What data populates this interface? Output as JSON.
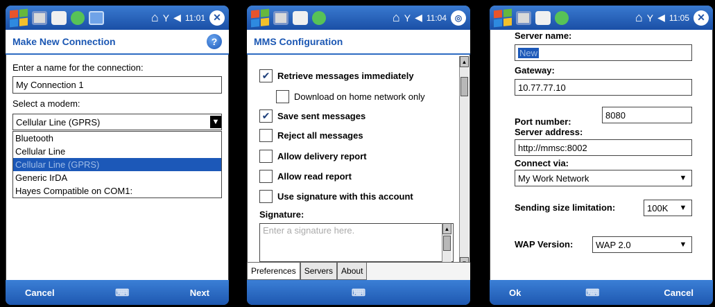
{
  "status": {
    "times": [
      "11:01",
      "11:04",
      "11:05"
    ]
  },
  "p1": {
    "title": "Make New Connection",
    "name_label": "Enter a name for the connection:",
    "name_value": "My Connection 1",
    "modem_label": "Select a modem:",
    "modem_value": "Cellular Line (GPRS)",
    "modem_options": [
      "Bluetooth",
      "Cellular Line",
      "Cellular Line (GPRS)",
      "Generic IrDA",
      "Hayes Compatible on COM1:"
    ],
    "selected_option_index": 2,
    "left_soft": "Cancel",
    "right_soft": "Next"
  },
  "p2": {
    "title": "MMS Configuration",
    "options": [
      {
        "label": "Retrieve messages immediately",
        "checked": true,
        "bold": true,
        "indent": false
      },
      {
        "label": "Download on home network only",
        "checked": false,
        "bold": false,
        "indent": true
      },
      {
        "label": "Save sent messages",
        "checked": true,
        "bold": true,
        "indent": false
      },
      {
        "label": "Reject all messages",
        "checked": false,
        "bold": true,
        "indent": false
      },
      {
        "label": "Allow delivery report",
        "checked": false,
        "bold": true,
        "indent": false
      },
      {
        "label": "Allow read report",
        "checked": false,
        "bold": true,
        "indent": false
      },
      {
        "label": "Use signature with this account",
        "checked": false,
        "bold": true,
        "indent": false
      }
    ],
    "signature_label": "Signature:",
    "signature_placeholder": "Enter a signature here.",
    "tabs": [
      "Preferences",
      "Servers",
      "About"
    ],
    "active_tab": "Preferences"
  },
  "p3": {
    "server_name_label": "Server name:",
    "server_name_value": "New",
    "gateway_label": "Gateway:",
    "gateway_value": "10.77.77.10",
    "port_label": "Port number:",
    "port_value": "8080",
    "server_address_label": "Server address:",
    "server_address_value": "http://mmsc:8002",
    "connect_via_label": "Connect via:",
    "connect_via_value": "My Work Network",
    "size_limit_label": "Sending size limitation:",
    "size_limit_value": "100K",
    "wap_label": "WAP Version:",
    "wap_value": "WAP 2.0",
    "left_soft": "Ok",
    "right_soft": "Cancel"
  },
  "icons": {
    "start": "windows-flag-icon",
    "home": "home-icon",
    "signal": "signal-icon",
    "speaker": "speaker-icon",
    "close": "close-icon",
    "ok": "ok-icon",
    "help": "help-icon",
    "keyboard": "keyboard-icon"
  }
}
